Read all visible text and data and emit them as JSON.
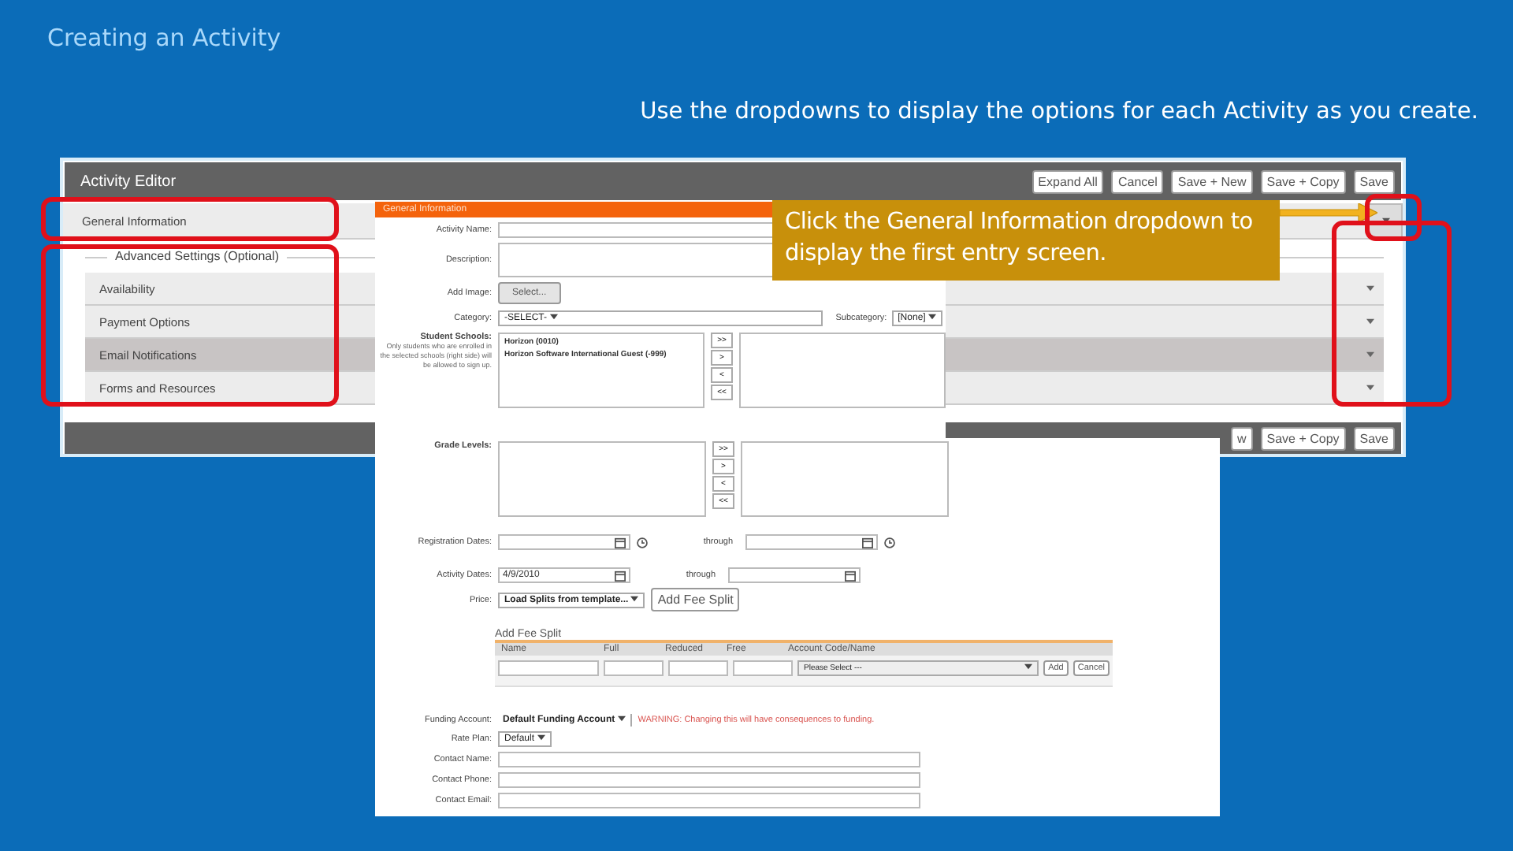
{
  "slide": {
    "title": "Creating an Activity",
    "instruction": "Use the dropdowns to display the options for each Activity as you create."
  },
  "editor": {
    "title": "Activity Editor",
    "top_buttons": [
      "Expand All",
      "Cancel",
      "Save + New",
      "Save + Copy",
      "Save"
    ],
    "general_section": "General Information",
    "advanced_legend": "Advanced Settings (Optional)",
    "advanced_sections": [
      {
        "label": "Availability",
        "highlighted": false
      },
      {
        "label": "Payment Options",
        "highlighted": false
      },
      {
        "label": "Email Notifications",
        "highlighted": true
      },
      {
        "label": "Forms and Resources",
        "highlighted": false
      }
    ],
    "bottom_buttons": [
      "w",
      "Save + Copy",
      "Save"
    ]
  },
  "callout": {
    "text": "Click the General Information dropdown to display the first entry screen."
  },
  "form": {
    "header": "General Information",
    "rows": [
      {
        "kind": "text",
        "label": "Activity Name:"
      },
      {
        "kind": "textarea",
        "label": "Description:"
      },
      {
        "kind": "button",
        "label": "Add Image:",
        "button": "Select..."
      },
      {
        "kind": "select",
        "label": "Category:",
        "value": "-SELECT-",
        "sub_label": "Subcategory:",
        "sub_value": "[None]"
      },
      {
        "kind": "dual-list",
        "label": "Student Schools:",
        "note": "Only students who are enrolled in the selected schools (right side) will be allowed to sign up.",
        "options": [
          "Horizon (0010)",
          "Horizon Software International Guest (-999)"
        ],
        "moves": [
          ">>",
          ">",
          "<",
          "<<"
        ]
      },
      {
        "kind": "dual-list",
        "label": "Grade Levels:",
        "moves": [
          ">>",
          ">",
          "<",
          "<<"
        ]
      },
      {
        "kind": "date-range",
        "label": "Registration Dates:",
        "through": "through",
        "clock": true
      },
      {
        "kind": "date-range",
        "label": "Activity Dates:",
        "value": "4/9/2010",
        "through": "through",
        "clock": false
      },
      {
        "kind": "price",
        "label": "Price:",
        "value": "Load Splits from template...",
        "button": "Add Fee Split"
      },
      {
        "kind": "fee-split",
        "title": "Add Fee Split",
        "columns": [
          "Name",
          "Full",
          "Reduced",
          "Free",
          "Account Code/Name"
        ],
        "account": "Please Select ---",
        "buttons": [
          "Add",
          "Cancel"
        ]
      },
      {
        "kind": "funding",
        "label": "Funding Account:",
        "value": "Default Funding Account",
        "warning": "WARNING: Changing this will have consequences to funding."
      },
      {
        "kind": "select",
        "label": "Rate Plan:",
        "value": "Default"
      },
      {
        "kind": "text",
        "label": "Contact Name:"
      },
      {
        "kind": "text",
        "label": "Contact Phone:"
      },
      {
        "kind": "text",
        "label": "Contact Email:"
      }
    ]
  }
}
